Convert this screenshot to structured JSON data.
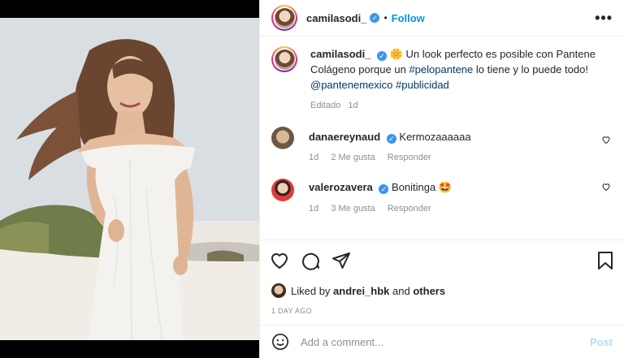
{
  "header": {
    "username": "camilasodi_",
    "separator": "•",
    "follow_label": "Follow",
    "more_label": "•••"
  },
  "caption": {
    "username": "camilasodi_",
    "emoji": "🌼",
    "text_1": "Un look perfecto es posible con Pantene Colágeno porque un",
    "hashtag_1": "#pelopantene",
    "text_2": "lo tiene y lo puede todo!",
    "mention": "@pantenemexico",
    "hashtag_2": "#publicidad",
    "edited": "Editado",
    "time": "1d"
  },
  "comments": [
    {
      "username": "danaereynaud",
      "text": "Kermozaaaaaa",
      "time": "1d",
      "likes": "2 Me gusta",
      "reply": "Responder"
    },
    {
      "username": "valerozavera",
      "text": "Bonitinga 🤩",
      "time": "1d",
      "likes": "3 Me gusta",
      "reply": "Responder"
    }
  ],
  "likes": {
    "prefix": "Liked by",
    "user": "andrei_hbk",
    "and": "and",
    "others": "others"
  },
  "timestamp": "1 DAY AGO",
  "add_comment": {
    "placeholder": "Add a comment...",
    "post_label": "Post"
  },
  "colors": {
    "accent": "#0095f6",
    "post_disabled": "#b2dffc",
    "verified": "#3897f0",
    "muted": "#8e8e8e",
    "link": "#00376b"
  },
  "icons": [
    "heart-icon",
    "comment-icon",
    "share-icon",
    "bookmark-icon",
    "emoji-icon"
  ]
}
